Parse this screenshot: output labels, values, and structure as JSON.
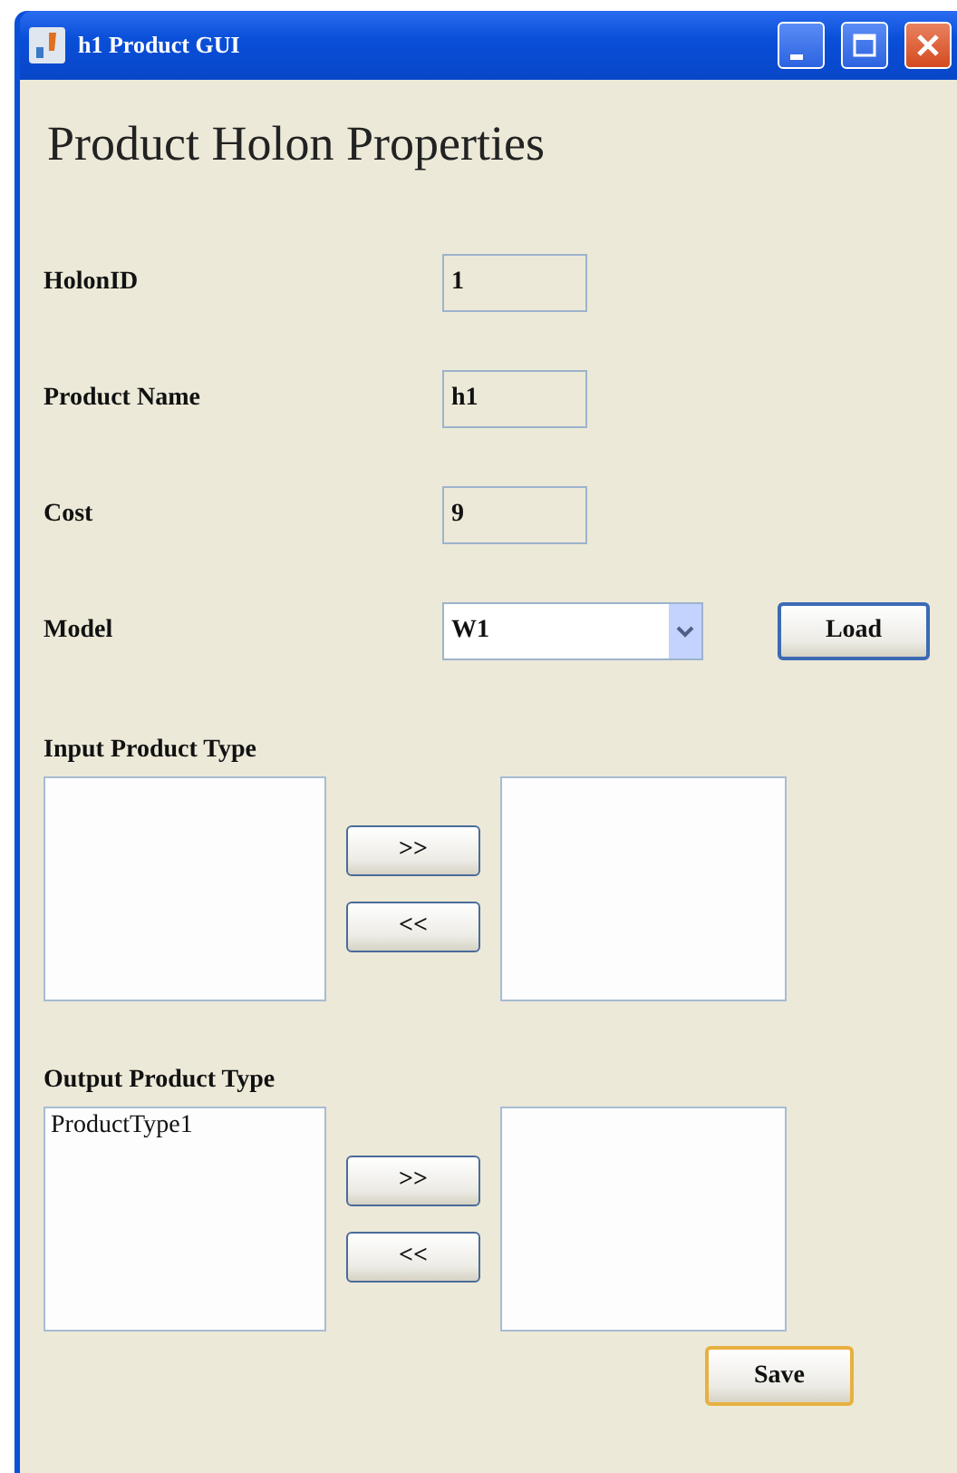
{
  "window": {
    "title": "h1 Product GUI"
  },
  "heading": "Product Holon Properties",
  "fields": [
    {
      "label": "HolonID",
      "value": "1"
    },
    {
      "label": "Product Name",
      "value": "h1"
    },
    {
      "label": "Cost",
      "value": "9"
    }
  ],
  "model": {
    "label": "Model",
    "value": "W1",
    "button": "Load"
  },
  "sections": [
    {
      "label": "Input Product Type",
      "buttons": [
        ">>",
        "<<"
      ]
    },
    {
      "label": "Output Product Type",
      "left_items": [
        "ProductType1"
      ],
      "buttons": [
        ">>",
        "<<"
      ]
    }
  ],
  "save_button": "Save"
}
